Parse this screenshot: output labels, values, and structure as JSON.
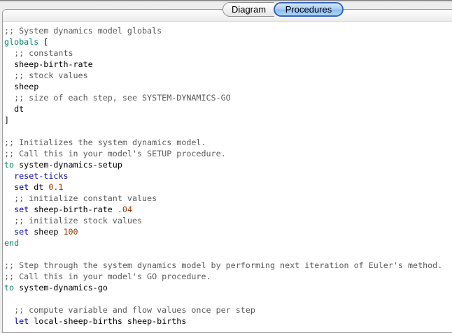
{
  "window": {
    "tabs": [
      {
        "label": "Diagram",
        "selected": false
      },
      {
        "label": "Procedures",
        "selected": true
      }
    ]
  },
  "colors": {
    "keyword": "#007F69",
    "command": "#0000AA",
    "constant": "#963700",
    "comment": "#5A5A5A",
    "default": "#000000",
    "selected_tab": "#3A64B5",
    "editor_bg": "#FFFFFF"
  },
  "editor": {
    "lines": [
      [
        [
          "m",
          ";; System dynamics model globals"
        ]
      ],
      [
        [
          "k",
          "globals"
        ],
        [
          "d",
          " ["
        ]
      ],
      [
        [
          "m",
          "  ;; constants"
        ]
      ],
      [
        [
          "d",
          "  sheep-birth-rate"
        ]
      ],
      [
        [
          "m",
          "  ;; stock values"
        ]
      ],
      [
        [
          "d",
          "  sheep"
        ]
      ],
      [
        [
          "m",
          "  ;; size of each step, see SYSTEM-DYNAMICS-GO"
        ]
      ],
      [
        [
          "d",
          "  dt"
        ]
      ],
      [
        [
          "d",
          "]"
        ]
      ],
      [],
      [
        [
          "m",
          ";; Initializes the system dynamics model."
        ]
      ],
      [
        [
          "m",
          ";; Call this in your model's SETUP procedure."
        ]
      ],
      [
        [
          "k",
          "to"
        ],
        [
          "d",
          " system-dynamics-setup"
        ]
      ],
      [
        [
          "d",
          "  "
        ],
        [
          "c",
          "reset-ticks"
        ]
      ],
      [
        [
          "d",
          "  "
        ],
        [
          "c",
          "set"
        ],
        [
          "d",
          " dt "
        ],
        [
          "n",
          "0.1"
        ]
      ],
      [
        [
          "m",
          "  ;; initialize constant values"
        ]
      ],
      [
        [
          "d",
          "  "
        ],
        [
          "c",
          "set"
        ],
        [
          "d",
          " sheep-birth-rate "
        ],
        [
          "n",
          ".04"
        ]
      ],
      [
        [
          "m",
          "  ;; initialize stock values"
        ]
      ],
      [
        [
          "d",
          "  "
        ],
        [
          "c",
          "set"
        ],
        [
          "d",
          " sheep "
        ],
        [
          "n",
          "100"
        ]
      ],
      [
        [
          "k",
          "end"
        ]
      ],
      [],
      [
        [
          "m",
          ";; Step through the system dynamics model by performing next iteration of Euler's method."
        ]
      ],
      [
        [
          "m",
          ";; Call this in your model's GO procedure."
        ]
      ],
      [
        [
          "k",
          "to"
        ],
        [
          "d",
          " system-dynamics-go"
        ]
      ],
      [],
      [
        [
          "m",
          "  ;; compute variable and flow values once per step"
        ]
      ],
      [
        [
          "d",
          "  "
        ],
        [
          "c",
          "let"
        ],
        [
          "d",
          " local-sheep-births sheep-births"
        ]
      ]
    ]
  }
}
